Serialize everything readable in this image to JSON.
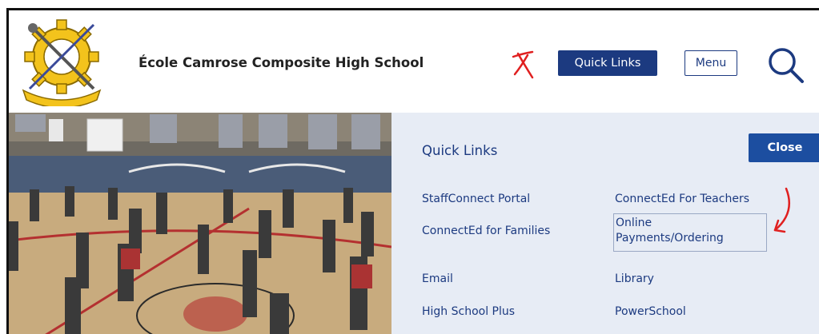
{
  "header": {
    "school_name": "École Camrose Composite High School",
    "quick_links_button": "Quick Links",
    "menu_button": "Menu"
  },
  "quick_links_panel": {
    "title": "Quick Links",
    "close_button": "Close",
    "links": [
      "StaffConnect Portal",
      "ConnectEd For Teachers",
      "ConnectEd for Families",
      "Online Payments/Ordering",
      "Email",
      "Library",
      "High School Plus",
      "PowerSchool"
    ]
  },
  "colors": {
    "brand_navy": "#1c3a80",
    "close_blue": "#1c4ea0",
    "panel_bg": "#e7ecf5",
    "annotation_red": "#e02020"
  },
  "icons": [
    "school-logo",
    "search-icon",
    "red-x-annotation",
    "red-arrow-annotation"
  ]
}
